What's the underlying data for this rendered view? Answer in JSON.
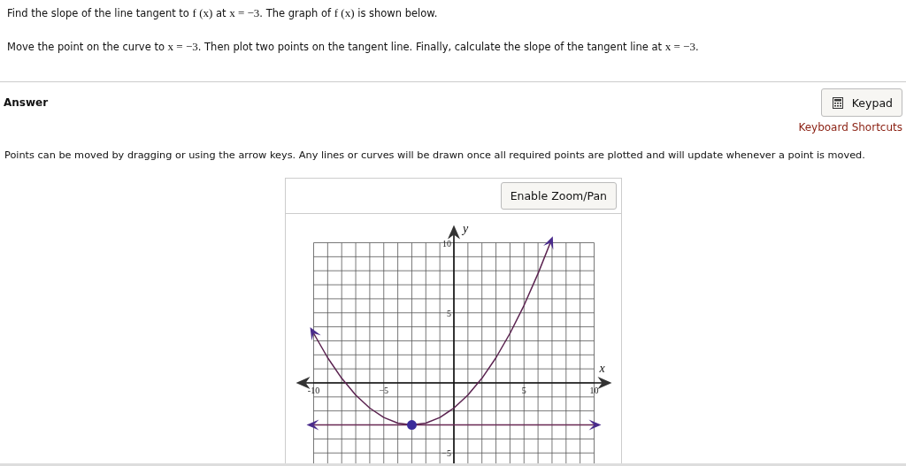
{
  "question": [
    [
      {
        "kind": "text",
        "text": "Find the slope of the line tangent to "
      },
      {
        "kind": "math",
        "text": "f (x)"
      },
      {
        "kind": "text",
        "text": " at "
      },
      {
        "kind": "math",
        "text": "x = −3"
      },
      {
        "kind": "text",
        "text": ". The graph of "
      },
      {
        "kind": "math",
        "text": "f (x)"
      },
      {
        "kind": "text",
        "text": " is shown below."
      }
    ],
    [
      {
        "kind": "text",
        "text": "Move the point on the curve to "
      },
      {
        "kind": "math",
        "text": "x = −3"
      },
      {
        "kind": "text",
        "text": ". Then plot two points on the tangent line. Finally, calculate the slope of the tangent line at "
      },
      {
        "kind": "math",
        "text": "x = −3"
      },
      {
        "kind": "text",
        "text": "."
      }
    ]
  ],
  "answer": {
    "heading": "Answer",
    "keypad_button": "Keypad",
    "shortcuts_link": "Keyboard Shortcuts",
    "instructions": "Points can be moved by dragging or using the arrow keys. Any lines or curves will be drawn once all required points are plotted and will update whenever a point is moved."
  },
  "graph": {
    "zoom_button": "Enable Zoom/Pan",
    "chart_data": {
      "type": "line",
      "xlabel": "x",
      "ylabel": "y",
      "xlim": [
        -10,
        10
      ],
      "ylim": [
        -6,
        10
      ],
      "xticks": [
        {
          "value": -10,
          "label": "-10"
        },
        {
          "value": -5,
          "label": "−5"
        },
        {
          "value": 5,
          "label": "5"
        },
        {
          "value": 10,
          "label": "10"
        }
      ],
      "yticks": [
        {
          "value": 10,
          "label": "10"
        },
        {
          "value": 5,
          "label": "5"
        },
        {
          "value": -5,
          "label": "−5"
        }
      ],
      "grid": true,
      "x": [
        -10,
        -9,
        -8,
        -7,
        -6,
        -5,
        -4,
        -3,
        -2,
        -1,
        0,
        1,
        2,
        3,
        4,
        5,
        6,
        6.87,
        8,
        9,
        10
      ],
      "series": [
        {
          "color": "#5b2350",
          "values": [
            3.53,
            1.8,
            0.33,
            -0.87,
            -1.8,
            -2.47,
            -2.87,
            -3,
            -2.87,
            -2.47,
            -1.8,
            -0.87,
            0.33,
            1.8,
            3.53,
            5.53,
            7.8,
            9.99,
            null,
            null,
            null
          ]
        },
        {
          "color": "#6a2a55",
          "values": [
            -3,
            -3,
            -3,
            -3,
            -3,
            -3,
            -3,
            -3,
            -3,
            -3,
            -3,
            -3,
            -3,
            -3,
            -3,
            -3,
            -3,
            -3,
            -3,
            -3,
            -3
          ]
        }
      ]
    }
  }
}
